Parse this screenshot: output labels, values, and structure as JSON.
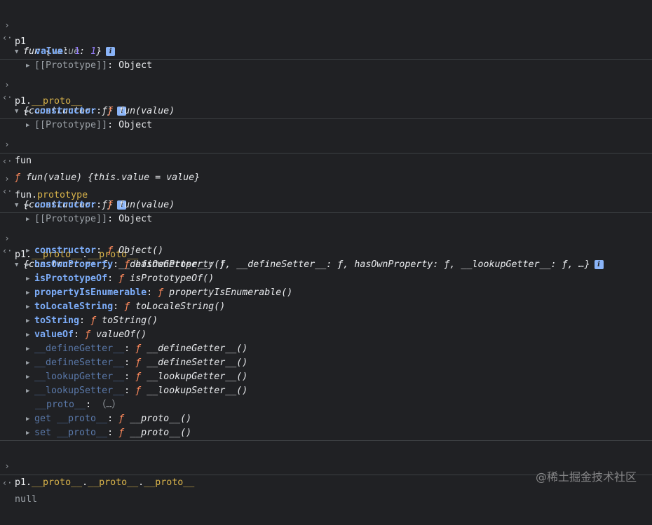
{
  "entries": [
    {
      "input": "p1",
      "preview": {
        "name": "fun ",
        "open": "{",
        "k": "value",
        "sep": ": ",
        "v": "1",
        "close": "}"
      },
      "children": [
        {
          "k": "value",
          "sep": ": ",
          "v": "1"
        },
        {
          "k": "[[Prototype]]",
          "sep": ": ",
          "v": "Object"
        }
      ]
    },
    {
      "input_a": "p1.",
      "input_b": "__proto__",
      "preview": "{constructor: ƒ}",
      "children": [
        {
          "k": "constructor",
          "sep": ": ",
          "f": "ƒ",
          "v": " fun(value)"
        },
        {
          "k": "[[Prototype]]",
          "sep": ": ",
          "v": "Object"
        }
      ]
    },
    {
      "input": "fun",
      "result_f": "ƒ",
      "result": " fun(value) {this.value = value}"
    },
    {
      "input_a": "fun.",
      "input_b": "prototype",
      "preview": "{constructor: ƒ}",
      "children": [
        {
          "k": "constructor",
          "sep": ": ",
          "f": "ƒ",
          "v": " fun(value)"
        },
        {
          "k": "[[Prototype]]",
          "sep": ": ",
          "v": "Object"
        }
      ]
    },
    {
      "input_a": "p1.",
      "input_b": "__proto__",
      "input_c": ".",
      "input_d": "__proto__",
      "preview": "{constructor: ƒ, __defineGetter__: ƒ, __defineSetter__: ƒ, hasOwnProperty: ƒ, __lookupGetter__: ƒ, …}",
      "children": [
        {
          "k": "constructor",
          "sep": ": ",
          "f": "ƒ",
          "v": " Object()"
        },
        {
          "k": "hasOwnProperty",
          "sep": ": ",
          "f": "ƒ",
          "v": " hasOwnProperty()"
        },
        {
          "k": "isPrototypeOf",
          "sep": ": ",
          "f": "ƒ",
          "v": " isPrototypeOf()"
        },
        {
          "k": "propertyIsEnumerable",
          "sep": ": ",
          "f": "ƒ",
          "v": " propertyIsEnumerable()"
        },
        {
          "k": "toLocaleString",
          "sep": ": ",
          "f": "ƒ",
          "v": " toLocaleString()"
        },
        {
          "k": "toString",
          "sep": ": ",
          "f": "ƒ",
          "v": " toString()"
        },
        {
          "k": "valueOf",
          "sep": ": ",
          "f": "ƒ",
          "v": " valueOf()"
        },
        {
          "k": "__defineGetter__",
          "sep": ": ",
          "f": "ƒ",
          "v": " __defineGetter__()"
        },
        {
          "k": "__defineSetter__",
          "sep": ": ",
          "f": "ƒ",
          "v": " __defineSetter__()"
        },
        {
          "k": "__lookupGetter__",
          "sep": ": ",
          "f": "ƒ",
          "v": " __lookupGetter__()"
        },
        {
          "k": "__lookupSetter__",
          "sep": ": ",
          "f": "ƒ",
          "v": " __lookupSetter__()"
        },
        {
          "k": "__proto__",
          "sep": ": ",
          "v": "（…）"
        },
        {
          "k": "get __proto__",
          "sep": ": ",
          "f": "ƒ",
          "v": " __proto__()"
        },
        {
          "k": "set __proto__",
          "sep": ": ",
          "f": "ƒ",
          "v": " __proto__()"
        }
      ]
    },
    {
      "input_a": "p1.",
      "input_b": "__proto__",
      "input_c": ".",
      "input_d": "__proto__",
      "input_e": ".",
      "input_f": "__proto__",
      "result": "null"
    }
  ],
  "icons": {
    "input_prompt": "›",
    "output_prompt": "‹·",
    "expanded": "▼",
    "collapsed": "▶",
    "info": "i"
  },
  "watermark": "@稀土掘金技术社区",
  "colors": {
    "background": "#202124",
    "key": "#7cacf8",
    "function": "#ff8a5c",
    "number": "#9980ff",
    "property": "#d7b24a"
  }
}
